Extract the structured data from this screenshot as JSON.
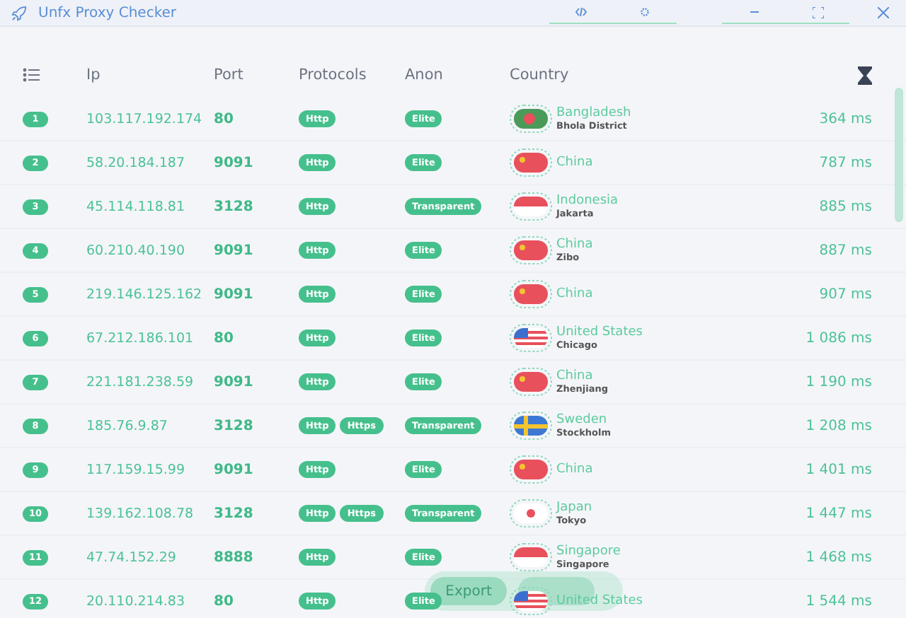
{
  "window": {
    "title": "Unfx Proxy Checker"
  },
  "table": {
    "columns": [
      "Ip",
      "Port",
      "Protocols",
      "Anon",
      "Country"
    ],
    "rows": [
      {
        "num": "1",
        "ip": "103.117.192.174",
        "port": "80",
        "protocols": [
          "Http"
        ],
        "anon": "Elite",
        "country": "Bangladesh",
        "city": "Bhola District",
        "flag": {
          "kind": "bd"
        },
        "time": "364 ms"
      },
      {
        "num": "2",
        "ip": "58.20.184.187",
        "port": "9091",
        "protocols": [
          "Http"
        ],
        "anon": "Elite",
        "country": "China",
        "flag": {
          "kind": "cn"
        },
        "time": "787 ms"
      },
      {
        "num": "3",
        "ip": "45.114.118.81",
        "port": "3128",
        "protocols": [
          "Http"
        ],
        "anon": "Transparent",
        "country": "Indonesia",
        "city": "Jakarta",
        "flag": {
          "kind": "id"
        },
        "time": "885 ms"
      },
      {
        "num": "4",
        "ip": "60.210.40.190",
        "port": "9091",
        "protocols": [
          "Http"
        ],
        "anon": "Elite",
        "country": "China",
        "city": "Zibo",
        "flag": {
          "kind": "cn"
        },
        "time": "887 ms"
      },
      {
        "num": "5",
        "ip": "219.146.125.162",
        "port": "9091",
        "protocols": [
          "Http"
        ],
        "anon": "Elite",
        "country": "China",
        "flag": {
          "kind": "cn"
        },
        "time": "907 ms"
      },
      {
        "num": "6",
        "ip": "67.212.186.101",
        "port": "80",
        "protocols": [
          "Http"
        ],
        "anon": "Elite",
        "country": "United States",
        "city": "Chicago",
        "flag": {
          "kind": "us"
        },
        "time": "1 086 ms"
      },
      {
        "num": "7",
        "ip": "221.181.238.59",
        "port": "9091",
        "protocols": [
          "Http"
        ],
        "anon": "Elite",
        "country": "China",
        "city": "Zhenjiang",
        "flag": {
          "kind": "cn"
        },
        "time": "1 190 ms"
      },
      {
        "num": "8",
        "ip": "185.76.9.87",
        "port": "3128",
        "protocols": [
          "Http",
          "Https"
        ],
        "anon": "Transparent",
        "country": "Sweden",
        "city": "Stockholm",
        "flag": {
          "kind": "se"
        },
        "time": "1 208 ms"
      },
      {
        "num": "9",
        "ip": "117.159.15.99",
        "port": "9091",
        "protocols": [
          "Http"
        ],
        "anon": "Elite",
        "country": "China",
        "flag": {
          "kind": "cn"
        },
        "time": "1 401 ms"
      },
      {
        "num": "10",
        "ip": "139.162.108.78",
        "port": "3128",
        "protocols": [
          "Http",
          "Https"
        ],
        "anon": "Transparent",
        "country": "Japan",
        "city": "Tokyo",
        "flag": {
          "kind": "jp"
        },
        "time": "1 447 ms"
      },
      {
        "num": "11",
        "ip": "47.74.152.29",
        "port": "8888",
        "protocols": [
          "Http"
        ],
        "anon": "Elite",
        "country": "Singapore",
        "city": "Singapore",
        "flag": {
          "kind": "sg"
        },
        "time": "1 468 ms"
      },
      {
        "num": "12",
        "ip": "20.110.214.83",
        "port": "80",
        "protocols": [
          "Http"
        ],
        "anon": "Elite",
        "country": "United States",
        "flag": {
          "kind": "us"
        },
        "time": "1 544 ms"
      }
    ]
  },
  "export_button": {
    "label": "Export"
  }
}
